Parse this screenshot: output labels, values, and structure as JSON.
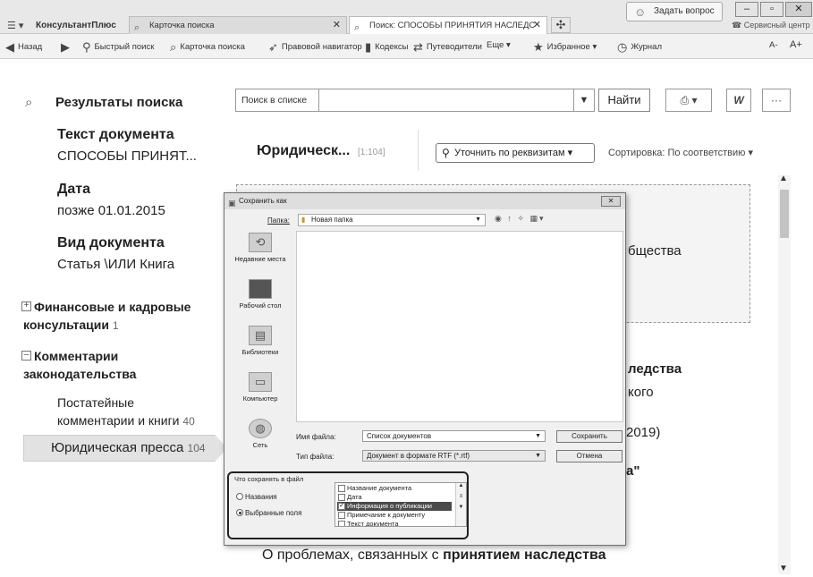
{
  "window": {
    "brand": "КонсультантПлюс",
    "tabs": [
      {
        "label": "Карточка поиска",
        "active": false
      },
      {
        "label": "Поиск: СПОСОБЫ ПРИНЯТИЯ НАСЛЕДС",
        "active": true
      }
    ],
    "ask_button": "Задать вопрос",
    "service_center": "Сервисный центр"
  },
  "toolbar": {
    "back": "Назад",
    "quick_search": "Быстрый поиск",
    "search_card": "Карточка поиска",
    "legal_navigator": "Правовой навигатор",
    "codes": "Кодексы",
    "guides": "Путеводители",
    "more": "Еще",
    "favorites": "Избранное",
    "journal": "Журнал",
    "font_minus": "A-",
    "font_plus": "A+"
  },
  "left": {
    "results_title": "Результаты поиска",
    "criteria": [
      {
        "heading": "Текст документа",
        "value": "СПОСОБЫ ПРИНЯТ..."
      },
      {
        "heading": "Дата",
        "value": "позже 01.01.2015"
      },
      {
        "heading": "Вид документа",
        "value": "Статья \\ИЛИ Книга"
      }
    ],
    "tree": [
      {
        "label_line1": "Финансовые и кадровые",
        "label_line2": "консультации",
        "count": "1",
        "expanded": false
      },
      {
        "label_line1": "Комментарии",
        "label_line2": "законодательства",
        "count": "",
        "expanded": true
      }
    ],
    "sub_items": [
      {
        "label_line1": "Постатейные",
        "label_line2": "комментарии и книги",
        "count": "40"
      },
      {
        "label": "Юридическая пресса",
        "count": "104",
        "selected": true
      }
    ]
  },
  "main": {
    "search_label": "Поиск в списке",
    "search_value": "",
    "find_button": "Найти",
    "word_button": "W",
    "more_button": "···",
    "section_title": "Юридическ...",
    "section_count": "[1:104]",
    "refine_button": "Уточнить по реквизитам",
    "sort_label": "Сортировка: По соответствию",
    "fragments": [
      "бщества",
      "ледства",
      "кого",
      "2019)",
      "а\""
    ],
    "bottom_text_normal": "О проблемах, связанных с ",
    "bottom_text_bold": "принятием наследства"
  },
  "dialog": {
    "title": "Сохранить как",
    "folder_label": "Папка:",
    "folder_value": "Новая папка",
    "places": [
      "Недавние места",
      "Рабочий стол",
      "Библиотеки",
      "Компьютер",
      "Сеть"
    ],
    "filename_label": "Имя файла:",
    "filename_value": "Список документов",
    "filetype_label": "Тип файла:",
    "filetype_value": "Документ в формате RTF (*.rtf)",
    "save_button": "Сохранить",
    "cancel_button": "Отмена",
    "save_group_title": "Что сохранять в файл",
    "radio_titles": "Названия",
    "radio_selected_fields": "Выбранные поля",
    "fields": [
      {
        "label": "Название документа",
        "checked": false,
        "selected": false
      },
      {
        "label": "Дата",
        "checked": false,
        "selected": false
      },
      {
        "label": "Информация о публикации",
        "checked": true,
        "selected": true
      },
      {
        "label": "Примечание к документу",
        "checked": false,
        "selected": false
      },
      {
        "label": "Текст документа",
        "checked": false,
        "selected": false
      }
    ]
  }
}
